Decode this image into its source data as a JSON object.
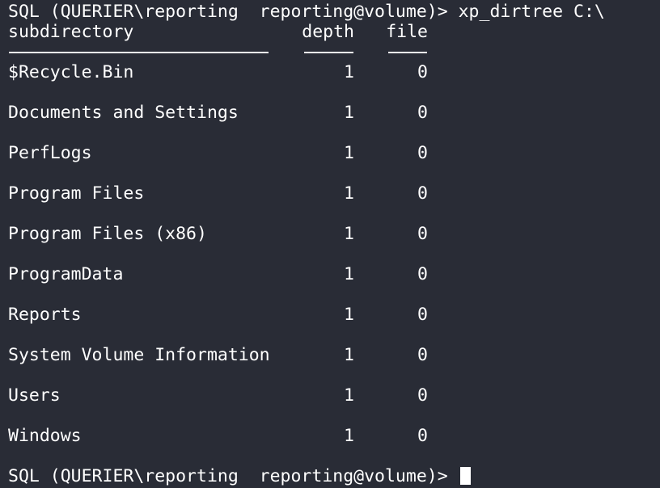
{
  "terminal": {
    "prompt_text": "SQL (QUERIER\\reporting  reporting@volume)> ",
    "command": "xp_dirtree C:\\",
    "columns": {
      "name": "subdirectory",
      "depth": "depth",
      "file": "file"
    },
    "rows": [
      {
        "name": "$Recycle.Bin",
        "depth": "1",
        "file": "0"
      },
      {
        "name": "Documents and Settings",
        "depth": "1",
        "file": "0"
      },
      {
        "name": "PerfLogs",
        "depth": "1",
        "file": "0"
      },
      {
        "name": "Program Files",
        "depth": "1",
        "file": "0"
      },
      {
        "name": "Program Files (x86)",
        "depth": "1",
        "file": "0"
      },
      {
        "name": "ProgramData",
        "depth": "1",
        "file": "0"
      },
      {
        "name": "Reports",
        "depth": "1",
        "file": "0"
      },
      {
        "name": "System Volume Information",
        "depth": "1",
        "file": "0"
      },
      {
        "name": "Users",
        "depth": "1",
        "file": "0"
      },
      {
        "name": "Windows",
        "depth": "1",
        "file": "0"
      }
    ],
    "final_prompt": "SQL (QUERIER\\reporting  reporting@volume)> "
  },
  "colors": {
    "background": "#292c36",
    "foreground": "#ffffff"
  }
}
